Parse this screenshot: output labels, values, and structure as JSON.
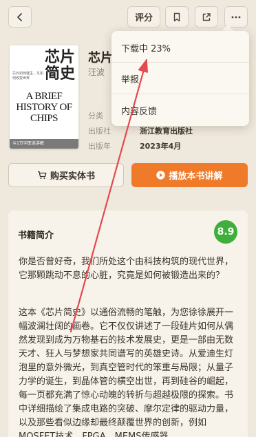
{
  "topbar": {
    "rate_label": "评分"
  },
  "book": {
    "cover": {
      "title_zh": "芯片简史",
      "subtitle_zh": "芯片如何诞生，又如何改变世界",
      "title_en": "A BRIEF HISTORY OF CHIPS",
      "strip_text": "斗1万字医迷讲解"
    },
    "title": "芯片",
    "author": "汪波",
    "meta": [
      {
        "label": "分类",
        "value": ""
      },
      {
        "label": "出版社",
        "value": "浙江教育出版社"
      },
      {
        "label": "出版年",
        "value": "2023年4月"
      }
    ]
  },
  "actions": {
    "buy_label": "购买实体书",
    "play_label": "播放本书讲解"
  },
  "intro": {
    "title": "书籍简介",
    "score": "8.9",
    "paragraphs": [
      "你是否曾好奇，我们所处这个由科技构筑的现代世界，它那颗跳动不息的心脏，究竟是如何被锻造出来的？",
      "这本《芯片简史》以通俗流畅的笔触，为您徐徐展开一幅波澜壮阔的画卷。它不仅仅讲述了一段硅片如何从偶然发现到成为万物基石的技术发展史，更是一部由无数天才、狂人与梦想家共同谱写的英雄史诗。从爱迪生灯泡里的意外微光，到真空管时代的笨重与局限；从量子力学的诞生，到晶体管的横空出世，再到硅谷的崛起，每一页都充满了惊心动魄的转折与超越极限的探索。书中详细描绘了集成电路的突破、摩尔定律的驱动力量，以及那些看似边缘却最终颠覆世界的创新，例如MOSFET技术、FPGA、MEMS传感器，"
    ]
  },
  "dropdown": {
    "items": [
      {
        "label": "下载中 23%"
      },
      {
        "label": "举报"
      },
      {
        "label": "内容反馈"
      }
    ],
    "download_progress": 0.23
  },
  "colors": {
    "background": "#efe8dc",
    "accent": "#ef7b2a",
    "score_green": "#3fae3a",
    "annotation_arrow": "#e5484d"
  },
  "icons": [
    "chevron-left-icon",
    "bookmark-icon",
    "share-icon",
    "more-icon",
    "cart-icon",
    "play-icon"
  ]
}
